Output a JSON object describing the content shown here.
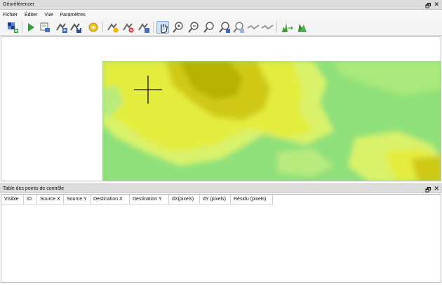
{
  "window": {
    "title": "Géoréférencer",
    "float_icon": "float-icon",
    "close_icon": "close-icon"
  },
  "menubar": {
    "items": [
      "Fichier",
      "Éditer",
      "Vue",
      "Paramètres"
    ]
  },
  "toolbar": {
    "buttons": [
      "open-raster-icon",
      "start-georeferencing-icon",
      "generate-gdal-script-icon",
      "load-gcp-points-icon",
      "save-gcp-points-icon",
      "transformation-settings-icon",
      "add-point-icon",
      "delete-point-icon",
      "move-point-icon",
      "pan-icon",
      "zoom-in-icon",
      "zoom-out-icon",
      "zoom-to-layer-icon",
      "zoom-last-icon",
      "zoom-next-icon",
      "link-georeferencer-to-qgis-icon",
      "link-qgis-to-georeferencer-icon",
      "full-histogram-stretch-icon",
      "local-histogram-stretch-icon"
    ],
    "active": "pan-icon"
  },
  "colors": {
    "titlebar": "#dcdcdc",
    "active_tool": "#cfe1f6",
    "raster_green": "#8fe07a",
    "raster_yellow": "#e4ec3c",
    "raster_dark": "#b6b200"
  },
  "gcp_table": {
    "title": "Table des points de contrôle",
    "columns": [
      "Visible",
      "ID",
      "Source X",
      "Source Y",
      "Destination X",
      "Destination Y",
      "dX(pixels)",
      "dY (pixels)",
      "Résidu (pixels)"
    ],
    "rows": []
  }
}
